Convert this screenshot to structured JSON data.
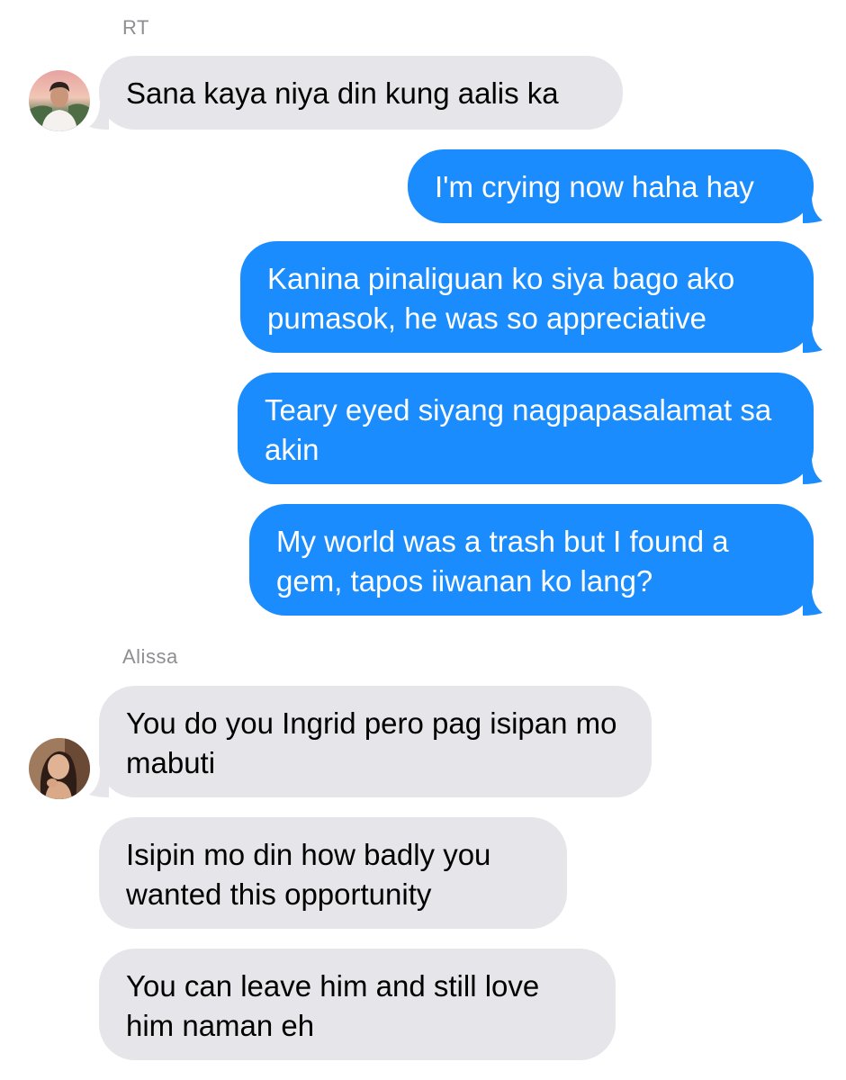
{
  "colors": {
    "incoming_bubble": "#e5e5ea",
    "outgoing_bubble": "#1a8cfd",
    "sender_label": "#8e8e93",
    "background": "#ffffff"
  },
  "conversation": {
    "groups": [
      {
        "sender": "RT",
        "direction": "incoming",
        "avatar_icon": "contact-photo-man",
        "messages": [
          "Sana kaya niya din kung aalis ka"
        ]
      },
      {
        "sender": "",
        "direction": "outgoing",
        "messages": [
          "I'm crying now haha hay",
          "Kanina pinaliguan ko siya bago ako pumasok, he was so appreciative",
          "Teary eyed siyang nagpapasalamat sa akin",
          "My world was a trash but I found a gem, tapos iiwanan ko lang?"
        ]
      },
      {
        "sender": "Alissa",
        "direction": "incoming",
        "avatar_icon": "contact-photo-woman",
        "messages": [
          "You do you Ingrid pero pag isipan mo mabuti",
          "Isipin mo din how badly you wanted this opportunity",
          "You can leave him and still love him naman eh"
        ]
      }
    ]
  }
}
